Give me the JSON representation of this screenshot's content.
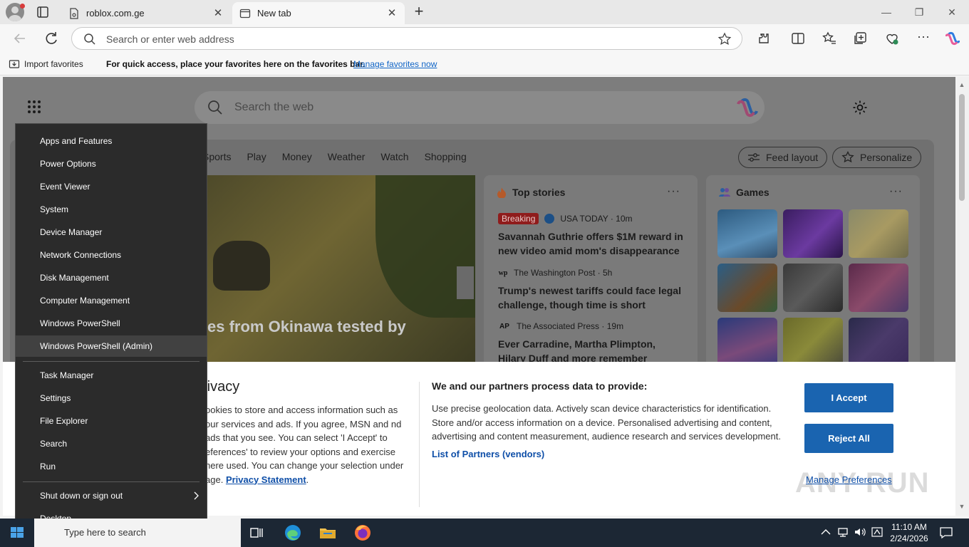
{
  "browser": {
    "tabs": [
      {
        "title": "roblox.com.ge"
      },
      {
        "title": "New tab"
      }
    ],
    "address_placeholder": "Search or enter web address",
    "favorites_bar": {
      "import_label": "Import favorites",
      "message": "For quick access, place your favorites here on the favorites bar.",
      "manage_link": "Manage favorites now"
    }
  },
  "newtab": {
    "search_placeholder": "Search the web",
    "nav_items": [
      "Sports",
      "Play",
      "Money",
      "Weather",
      "Watch",
      "Shopping"
    ],
    "feed_layout_label": "Feed layout",
    "personalize_label": "Personalize",
    "hero_headline": "es from Okinawa tested by",
    "top_stories": {
      "title": "Top stories",
      "items": [
        {
          "badge": "Breaking",
          "source": "USA TODAY · 10m",
          "title": "Savannah Guthrie offers $1M reward in new video amid mom's disappearance"
        },
        {
          "source": "The Washington Post · 5h",
          "title": "Trump's newest tariffs could face legal challenge, though time is short"
        },
        {
          "source": "The Associated Press · 19m",
          "title": "Ever Carradine, Martha Plimpton, Hilary Duff and more remember Robert..."
        }
      ]
    },
    "games": {
      "title": "Games"
    }
  },
  "consent": {
    "privacy_title": "rivacy",
    "privacy_text": "ookies to store and access information such as our services and ads. If you agree, MSN and nd ads that you see. You can select 'I Accept' to eferences' to review your options and exercise here used. You can change your selection under age.",
    "privacy_link": "Privacy Statement",
    "partners_title": "We and our partners process data to provide:",
    "partners_text": "Use precise geolocation data. Actively scan device characteristics for identification. Store and/or access information on a device. Personalised advertising and content, advertising and content measurement, audience research and services development.",
    "partners_link": "List of Partners (vendors)",
    "accept_label": "I Accept",
    "reject_label": "Reject All",
    "manage_label": "Manage Preferences"
  },
  "context_menu": {
    "group1": [
      "Apps and Features",
      "Power Options",
      "Event Viewer",
      "System",
      "Device Manager",
      "Network Connections",
      "Disk Management",
      "Computer Management",
      "Windows PowerShell",
      "Windows PowerShell (Admin)"
    ],
    "group2": [
      "Task Manager",
      "Settings",
      "File Explorer",
      "Search",
      "Run"
    ],
    "group3": [
      "Shut down or sign out",
      "Desktop"
    ]
  },
  "taskbar": {
    "search_placeholder": "Type here to search",
    "time": "11:10 AM",
    "date": "2/24/2026"
  },
  "watermark": "ANY RUN",
  "colors": {
    "accent": "#1a64b0",
    "link": "#0f64c6",
    "menu_bg": "#2b2b2b",
    "taskbar_bg": "#1c2734",
    "breaking": "#8f1c1c"
  }
}
